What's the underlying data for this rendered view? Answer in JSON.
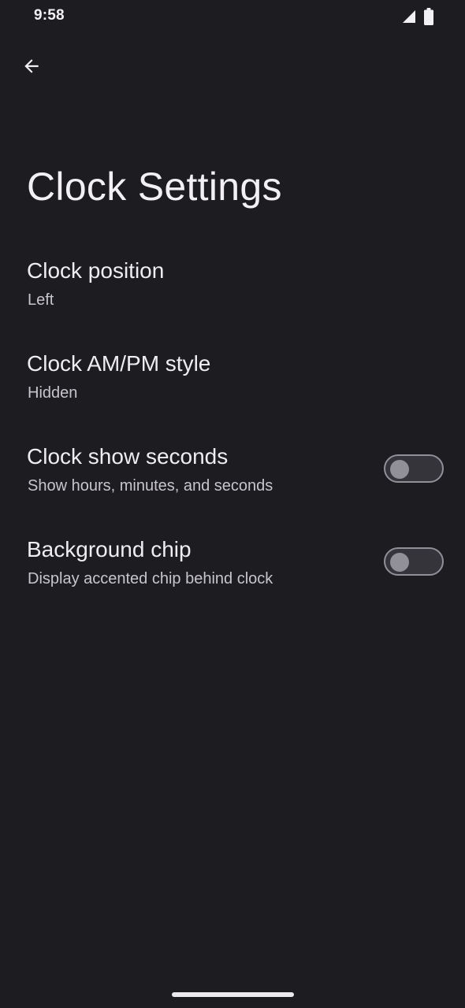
{
  "status_bar": {
    "time": "9:58",
    "icons": [
      "signal-icon",
      "battery-icon"
    ]
  },
  "toolbar": {
    "back_icon": "arrow-back-icon"
  },
  "page": {
    "title": "Clock Settings"
  },
  "settings": [
    {
      "title": "Clock position",
      "summary": "Left",
      "has_toggle": false
    },
    {
      "title": "Clock AM/PM style",
      "summary": "Hidden",
      "has_toggle": false
    },
    {
      "title": "Clock show seconds",
      "summary": "Show hours, minutes, and seconds",
      "has_toggle": true,
      "toggle_on": false
    },
    {
      "title": "Background chip",
      "summary": "Display accented chip behind clock",
      "has_toggle": true,
      "toggle_on": false
    }
  ],
  "colors": {
    "background": "#1c1c21",
    "text_primary": "#efedf2",
    "text_secondary": "#c8c5cc",
    "toggle_outline": "#918f98",
    "toggle_track": "#35343b"
  }
}
